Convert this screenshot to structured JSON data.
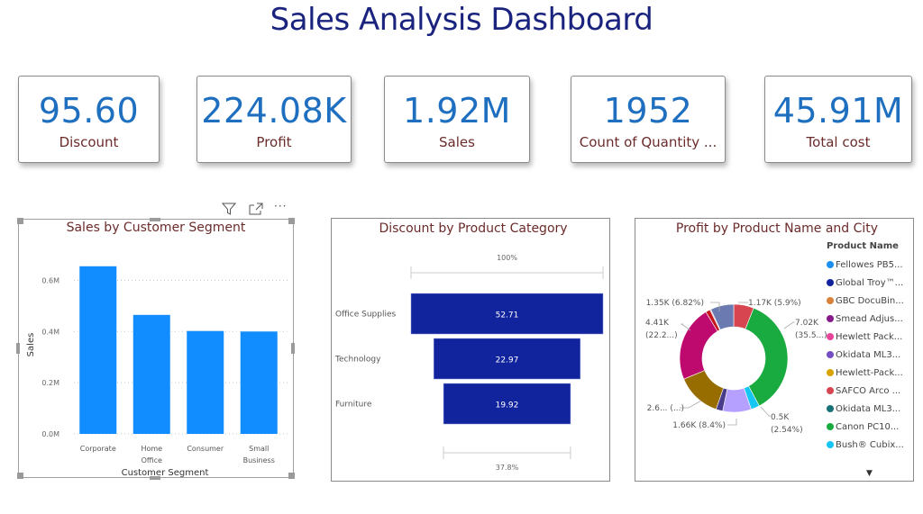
{
  "header": {
    "title": "Sales Analysis Dashboard"
  },
  "kpis": [
    {
      "value": "95.60",
      "label": "Discount"
    },
    {
      "value": "224.08K",
      "label": "Profit"
    },
    {
      "value": "1.92M",
      "label": "Sales"
    },
    {
      "value": "1952",
      "label": "Count of Quantity ..."
    },
    {
      "value": "45.91M",
      "label": "Total cost"
    }
  ],
  "visual_header": {
    "filter_icon": "filter-icon",
    "focus_icon": "focus-mode-icon",
    "more_icon": "more-options-icon"
  },
  "chart_data": [
    {
      "type": "bar",
      "title": "Sales by Customer Segment",
      "xlabel": "Customer Segment",
      "ylabel": "Sales",
      "categories": [
        "Corporate",
        "Home Office",
        "Consumer",
        "Small Business"
      ],
      "category_lines": [
        [
          "Corporate"
        ],
        [
          "Home",
          "Office"
        ],
        [
          "Consumer"
        ],
        [
          "Small",
          "Business"
        ]
      ],
      "values": [
        655000,
        465000,
        402000,
        400000
      ],
      "ylim": [
        0,
        0.7
      ],
      "yticks": [
        "0.0M",
        "0.2M",
        "0.4M",
        "0.6M"
      ],
      "ytick_values": [
        0,
        200000,
        400000,
        600000
      ],
      "grid": true,
      "color": "#118dff"
    },
    {
      "type": "bar",
      "subtype": "funnel",
      "title": "Discount by Product Category",
      "categories": [
        "Office Supplies",
        "Technology",
        "Furniture"
      ],
      "values": [
        52.71,
        22.97,
        19.92
      ],
      "value_labels": [
        "52.71",
        "22.97",
        "19.92"
      ],
      "top_percent_label": "100%",
      "bottom_percent_label": "37.8%",
      "color": "#12239e"
    },
    {
      "type": "pie",
      "subtype": "donut",
      "title": "Profit by Product Name and City",
      "legend_title": "Product Name",
      "legend_placement": "right",
      "slices": [
        {
          "name": "SAFCO Arco ...",
          "value": 1170,
          "percent": 5.9,
          "label": "1.17K (5.9%)",
          "color": "#d64550"
        },
        {
          "name": "Canon PC10...",
          "value": 7020,
          "percent": 35.5,
          "label": "7.02K (35.5...)",
          "color": "#1aab40"
        },
        {
          "name": "Bush® Cubix...",
          "value": 500,
          "percent": 2.54,
          "label": "0.5K (2.54%)",
          "color": "#15c6f4"
        },
        {
          "name": "Lavender slice",
          "value": 1660,
          "percent": 8.4,
          "label": "1.66K (8.4%)",
          "color": "#b6a0ff"
        },
        {
          "name": "Purple slice",
          "value": 390,
          "percent": 1.97,
          "label": "",
          "color": "#4a3c8c"
        },
        {
          "name": "Brown slice",
          "value": 2600,
          "percent": 13.15,
          "label": "2.6... (...)",
          "color": "#976d00"
        },
        {
          "name": "Magenta slice",
          "value": 4410,
          "percent": 22.2,
          "label": "4.41K (22.2...)",
          "color": "#be0a6e"
        },
        {
          "name": "Red slice",
          "value": 260,
          "percent": 1.3,
          "label": "",
          "color": "#c4161c"
        },
        {
          "name": "Pink slice",
          "value": 60,
          "percent": 0.3,
          "label": "",
          "color": "#e0a0b0"
        },
        {
          "name": "Slate slice",
          "value": 1350,
          "percent": 6.82,
          "label": "1.35K (6.82%)",
          "color": "#6b7ab0"
        }
      ]
    }
  ],
  "legend": {
    "title": "Product Name",
    "items": [
      {
        "label": "Fellowes PB5...",
        "color": "#1b8ff0"
      },
      {
        "label": "Global Troy™...",
        "color": "#12239e"
      },
      {
        "label": "GBC DocuBin...",
        "color": "#d9823b"
      },
      {
        "label": "Smead Adjus...",
        "color": "#861a8a"
      },
      {
        "label": "Hewlett Pack...",
        "color": "#e8449a"
      },
      {
        "label": "Okidata ML3...",
        "color": "#744ec2"
      },
      {
        "label": "Hewlett-Pack...",
        "color": "#d9a300"
      },
      {
        "label": "SAFCO Arco ...",
        "color": "#d64550"
      },
      {
        "label": "Okidata ML3...",
        "color": "#197278"
      },
      {
        "label": "Canon PC10...",
        "color": "#1aab40"
      },
      {
        "label": "Bush® Cubix...",
        "color": "#15c6f4"
      }
    ],
    "more_glyph": "▼"
  }
}
